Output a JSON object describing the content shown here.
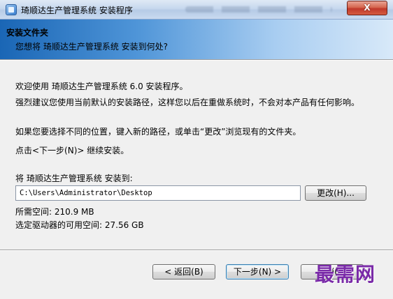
{
  "window": {
    "title": "琦顺达生产管理系统 安装程序",
    "close_glyph": "X"
  },
  "header": {
    "title": "安装文件夹",
    "subtitle": "您想将 琦顺达生产管理系统 安装到何处?"
  },
  "body": {
    "welcome": "欢迎使用 琦顺达生产管理系统 6.0 安装程序。",
    "recommend": "强烈建议您使用当前默认的安装路径，这样您以后在重做系统时，不会对本产品有任何影响。",
    "choose_other": "如果您要选择不同的位置，键入新的路径，或单击“更改”浏览现有的文件夹。",
    "click_next": "点击<下一步(N)> 继续安装。",
    "install_to_label": "将 琦顺达生产管理系统 安装到:",
    "install_path": "C:\\Users\\Administrator\\Desktop",
    "browse_label": "更改(H)...",
    "space_required": "所需空间: 210.9 MB",
    "space_available": "选定驱动器的可用空间: 27.56 GB"
  },
  "footer": {
    "back_label": "< 返回(B)",
    "next_label": "下一步(N) >",
    "cancel_label": "取消(C)"
  },
  "watermark": "最需网"
}
